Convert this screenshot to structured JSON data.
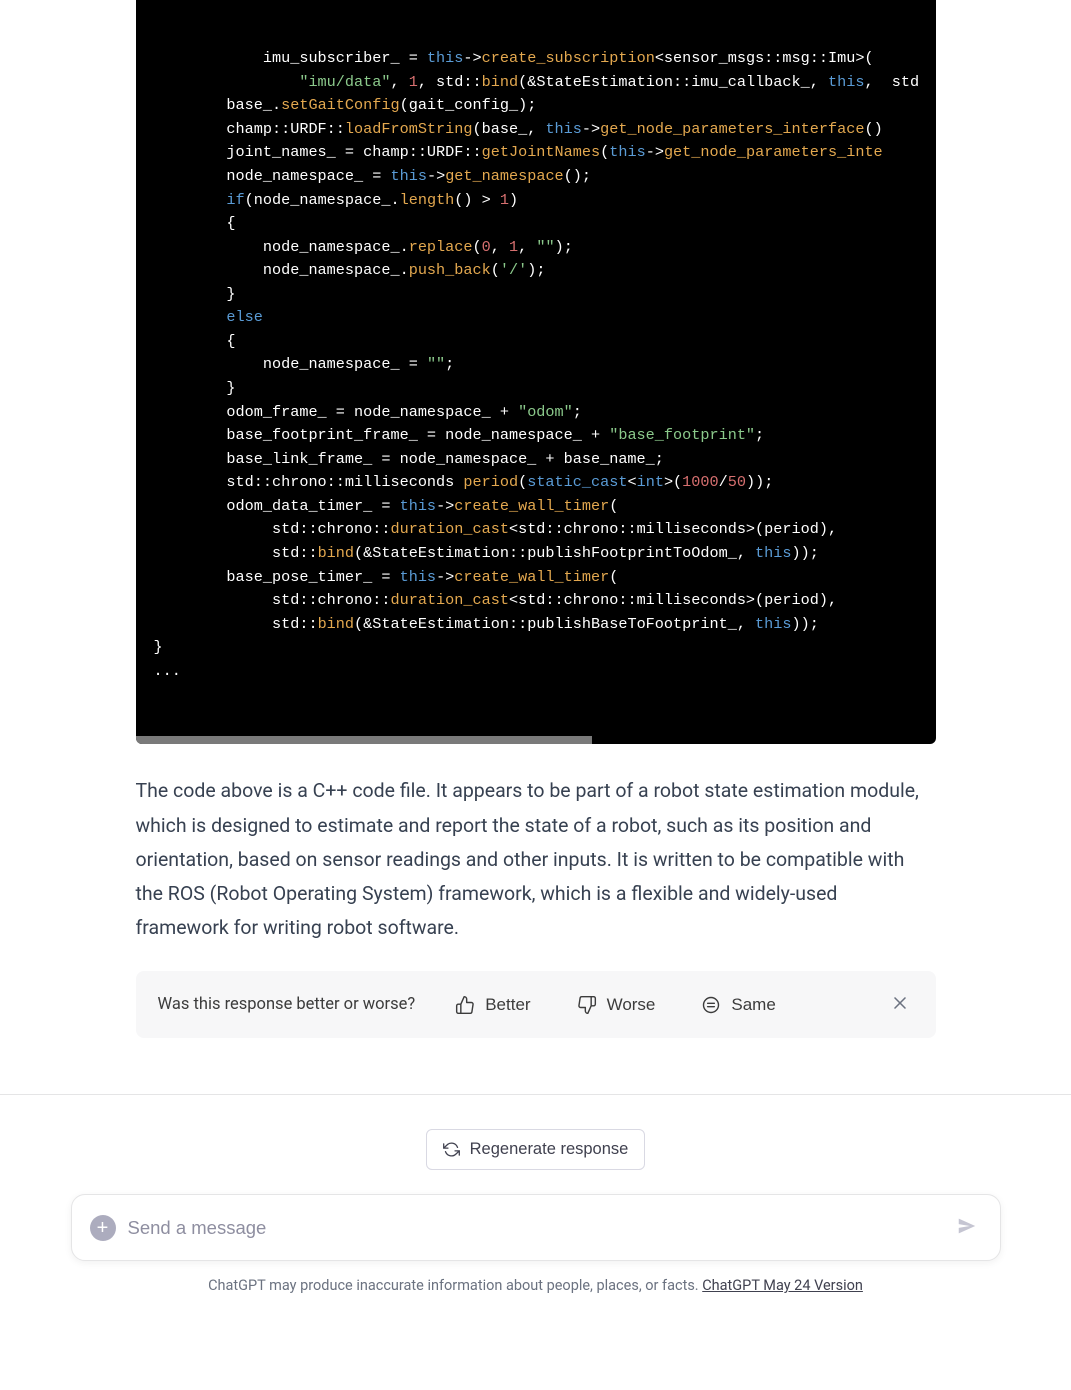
{
  "code": {
    "lines": [
      {
        "indent": 3,
        "tokens": [
          {
            "t": "plain",
            "v": "imu_subscriber_ = "
          },
          {
            "t": "this",
            "v": "this"
          },
          {
            "t": "plain",
            "v": "->"
          },
          {
            "t": "fn",
            "v": "create_subscription"
          },
          {
            "t": "plain",
            "v": "<sensor_msgs::msg::Imu>("
          }
        ]
      },
      {
        "indent": 4,
        "tokens": [
          {
            "t": "str",
            "v": "\"imu/data\""
          },
          {
            "t": "plain",
            "v": ", "
          },
          {
            "t": "num",
            "v": "1"
          },
          {
            "t": "plain",
            "v": ", std::"
          },
          {
            "t": "fn",
            "v": "bind"
          },
          {
            "t": "plain",
            "v": "(&StateEstimation::imu_callback_, "
          },
          {
            "t": "this",
            "v": "this"
          },
          {
            "t": "plain",
            "v": ",  std"
          }
        ]
      },
      {
        "indent": 2,
        "tokens": [
          {
            "t": "plain",
            "v": "base_."
          },
          {
            "t": "fn",
            "v": "setGaitConfig"
          },
          {
            "t": "plain",
            "v": "(gait_config_);"
          }
        ]
      },
      {
        "indent": 2,
        "tokens": [
          {
            "t": "plain",
            "v": "champ::URDF::"
          },
          {
            "t": "fn",
            "v": "loadFromString"
          },
          {
            "t": "plain",
            "v": "(base_, "
          },
          {
            "t": "this",
            "v": "this"
          },
          {
            "t": "plain",
            "v": "->"
          },
          {
            "t": "fn",
            "v": "get_node_parameters_interface"
          },
          {
            "t": "plain",
            "v": "()"
          }
        ]
      },
      {
        "indent": 2,
        "tokens": [
          {
            "t": "plain",
            "v": "joint_names_ = champ::URDF::"
          },
          {
            "t": "fn",
            "v": "getJointNames"
          },
          {
            "t": "plain",
            "v": "("
          },
          {
            "t": "this",
            "v": "this"
          },
          {
            "t": "plain",
            "v": "->"
          },
          {
            "t": "fn",
            "v": "get_node_parameters_inte"
          }
        ]
      },
      {
        "indent": 0,
        "tokens": [
          {
            "t": "plain",
            "v": ""
          }
        ]
      },
      {
        "indent": 2,
        "tokens": [
          {
            "t": "plain",
            "v": "node_namespace_ = "
          },
          {
            "t": "this",
            "v": "this"
          },
          {
            "t": "plain",
            "v": "->"
          },
          {
            "t": "fn",
            "v": "get_namespace"
          },
          {
            "t": "plain",
            "v": "();"
          }
        ]
      },
      {
        "indent": 2,
        "tokens": [
          {
            "t": "kw",
            "v": "if"
          },
          {
            "t": "plain",
            "v": "(node_namespace_."
          },
          {
            "t": "prop",
            "v": "length"
          },
          {
            "t": "plain",
            "v": "() > "
          },
          {
            "t": "num",
            "v": "1"
          },
          {
            "t": "plain",
            "v": ")"
          }
        ]
      },
      {
        "indent": 2,
        "tokens": [
          {
            "t": "plain",
            "v": "{"
          }
        ]
      },
      {
        "indent": 3,
        "tokens": [
          {
            "t": "plain",
            "v": "node_namespace_."
          },
          {
            "t": "fn",
            "v": "replace"
          },
          {
            "t": "plain",
            "v": "("
          },
          {
            "t": "num",
            "v": "0"
          },
          {
            "t": "plain",
            "v": ", "
          },
          {
            "t": "num",
            "v": "1"
          },
          {
            "t": "plain",
            "v": ", "
          },
          {
            "t": "str",
            "v": "\"\""
          },
          {
            "t": "plain",
            "v": ");"
          }
        ]
      },
      {
        "indent": 3,
        "tokens": [
          {
            "t": "plain",
            "v": "node_namespace_."
          },
          {
            "t": "fn",
            "v": "push_back"
          },
          {
            "t": "plain",
            "v": "("
          },
          {
            "t": "str",
            "v": "'/'"
          },
          {
            "t": "plain",
            "v": ");"
          }
        ]
      },
      {
        "indent": 2,
        "tokens": [
          {
            "t": "plain",
            "v": "}"
          }
        ]
      },
      {
        "indent": 2,
        "tokens": [
          {
            "t": "kw",
            "v": "else"
          }
        ]
      },
      {
        "indent": 2,
        "tokens": [
          {
            "t": "plain",
            "v": "{"
          }
        ]
      },
      {
        "indent": 3,
        "tokens": [
          {
            "t": "plain",
            "v": "node_namespace_ = "
          },
          {
            "t": "str",
            "v": "\"\""
          },
          {
            "t": "plain",
            "v": ";"
          }
        ]
      },
      {
        "indent": 2,
        "tokens": [
          {
            "t": "plain",
            "v": "}"
          }
        ]
      },
      {
        "indent": 0,
        "tokens": [
          {
            "t": "plain",
            "v": ""
          }
        ]
      },
      {
        "indent": 2,
        "tokens": [
          {
            "t": "plain",
            "v": "odom_frame_ = node_namespace_ + "
          },
          {
            "t": "str",
            "v": "\"odom\""
          },
          {
            "t": "plain",
            "v": ";"
          }
        ]
      },
      {
        "indent": 2,
        "tokens": [
          {
            "t": "plain",
            "v": "base_footprint_frame_ = node_namespace_ + "
          },
          {
            "t": "str",
            "v": "\"base_footprint\""
          },
          {
            "t": "plain",
            "v": ";"
          }
        ]
      },
      {
        "indent": 2,
        "tokens": [
          {
            "t": "plain",
            "v": "base_link_frame_ = node_namespace_ + base_name_;"
          }
        ]
      },
      {
        "indent": 0,
        "tokens": [
          {
            "t": "plain",
            "v": ""
          }
        ]
      },
      {
        "indent": 2,
        "tokens": [
          {
            "t": "plain",
            "v": "std::chrono::milliseconds "
          },
          {
            "t": "fn",
            "v": "period"
          },
          {
            "t": "plain",
            "v": "("
          },
          {
            "t": "kw",
            "v": "static_cast"
          },
          {
            "t": "plain",
            "v": "<"
          },
          {
            "t": "kw",
            "v": "int"
          },
          {
            "t": "plain",
            "v": ">("
          },
          {
            "t": "num",
            "v": "1000"
          },
          {
            "t": "plain",
            "v": "/"
          },
          {
            "t": "num",
            "v": "50"
          },
          {
            "t": "plain",
            "v": "));"
          }
        ]
      },
      {
        "indent": 0,
        "tokens": [
          {
            "t": "plain",
            "v": ""
          }
        ]
      },
      {
        "indent": 2,
        "tokens": [
          {
            "t": "plain",
            "v": "odom_data_timer_ = "
          },
          {
            "t": "this",
            "v": "this"
          },
          {
            "t": "plain",
            "v": "->"
          },
          {
            "t": "fn",
            "v": "create_wall_timer"
          },
          {
            "t": "plain",
            "v": "("
          }
        ]
      },
      {
        "indent": 3,
        "tokens": [
          {
            "t": "plain",
            "v": " std::chrono::"
          },
          {
            "t": "fn",
            "v": "duration_cast"
          },
          {
            "t": "plain",
            "v": "<std::chrono::milliseconds>(period),"
          }
        ]
      },
      {
        "indent": 3,
        "tokens": [
          {
            "t": "plain",
            "v": " std::"
          },
          {
            "t": "fn",
            "v": "bind"
          },
          {
            "t": "plain",
            "v": "(&StateEstimation::publishFootprintToOdom_, "
          },
          {
            "t": "this",
            "v": "this"
          },
          {
            "t": "plain",
            "v": "));"
          }
        ]
      },
      {
        "indent": 0,
        "tokens": [
          {
            "t": "plain",
            "v": ""
          }
        ]
      },
      {
        "indent": 2,
        "tokens": [
          {
            "t": "plain",
            "v": "base_pose_timer_ = "
          },
          {
            "t": "this",
            "v": "this"
          },
          {
            "t": "plain",
            "v": "->"
          },
          {
            "t": "fn",
            "v": "create_wall_timer"
          },
          {
            "t": "plain",
            "v": "("
          }
        ]
      },
      {
        "indent": 3,
        "tokens": [
          {
            "t": "plain",
            "v": " std::chrono::"
          },
          {
            "t": "fn",
            "v": "duration_cast"
          },
          {
            "t": "plain",
            "v": "<std::chrono::milliseconds>(period),"
          }
        ]
      },
      {
        "indent": 3,
        "tokens": [
          {
            "t": "plain",
            "v": " std::"
          },
          {
            "t": "fn",
            "v": "bind"
          },
          {
            "t": "plain",
            "v": "(&StateEstimation::publishBaseToFootprint_, "
          },
          {
            "t": "this",
            "v": "this"
          },
          {
            "t": "plain",
            "v": "));"
          }
        ]
      },
      {
        "indent": 0,
        "tokens": [
          {
            "t": "plain",
            "v": "}"
          }
        ]
      },
      {
        "indent": 0,
        "tokens": [
          {
            "t": "plain",
            "v": "..."
          }
        ]
      }
    ]
  },
  "explain": "The code above is a C++ code file. It appears to be part of a robot state estimation module, which is designed to estimate and report the state of a robot, such as its position and orientation, based on sensor readings and other inputs. It is written to be compatible with the ROS (Robot Operating System) framework, which is a flexible and widely-used framework for writing robot software.",
  "feedback": {
    "question": "Was this response better or worse?",
    "better": "Better",
    "worse": "Worse",
    "same": "Same"
  },
  "regen": "Regenerate response",
  "input": {
    "placeholder": "Send a message"
  },
  "disclaimer": {
    "text": "ChatGPT may produce inaccurate information about people, places, or facts. ",
    "link": "ChatGPT May 24 Version"
  }
}
